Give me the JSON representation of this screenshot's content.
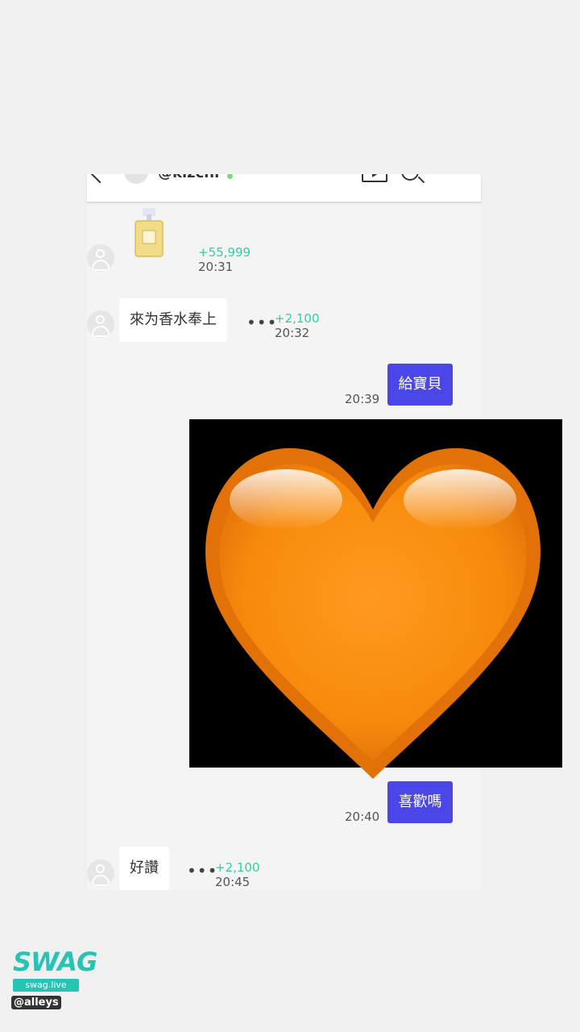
{
  "header": {
    "username": "@kizchi"
  },
  "messages": [
    {
      "type": "gift",
      "coins": "+55,999",
      "time": "20:31"
    },
    {
      "type": "incoming",
      "text": "來为香水奉上",
      "coins": "+2,100",
      "time": "20:32"
    },
    {
      "type": "outgoing",
      "text": "給寶貝",
      "time": "20:39"
    },
    {
      "type": "image",
      "icon": "orange-heart-icon"
    },
    {
      "type": "outgoing",
      "text": "喜歡嗎",
      "time": "20:40"
    },
    {
      "type": "incoming",
      "text": "好讚",
      "coins": "+2,100",
      "time": "20:45"
    }
  ],
  "watermark": {
    "logo": "SWAG",
    "site": "swag.live",
    "handle": "@alleys"
  },
  "colors": {
    "accent": "#4b46e8",
    "coins": "#2ecfa6",
    "heart": "#f7910f"
  }
}
